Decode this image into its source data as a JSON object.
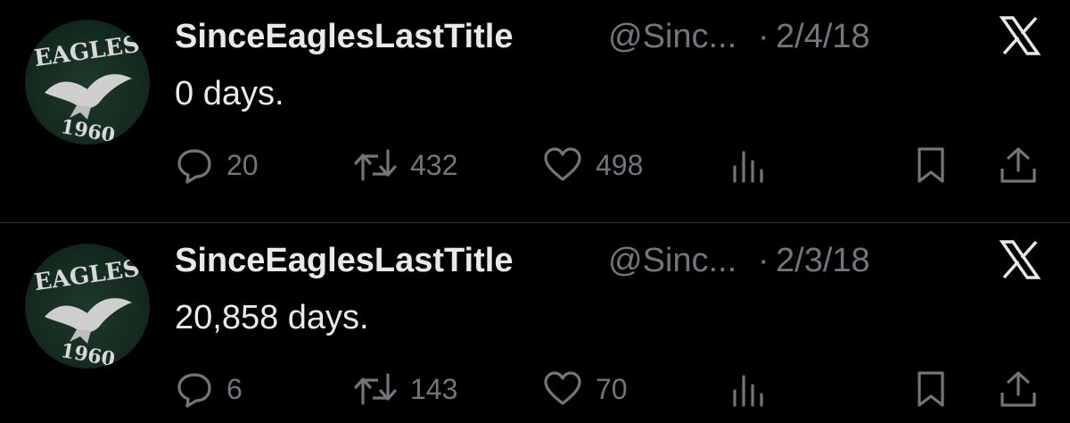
{
  "tweets": [
    {
      "author_name": "SinceEaglesLastTitle",
      "handle": "@Sinc...",
      "separator": "·",
      "date": "2/4/18",
      "text": "0 days.",
      "avatar": {
        "top_text": "EAGLES",
        "bottom_text": "1960"
      },
      "stats": {
        "replies": "20",
        "retweets": "432",
        "likes": "498"
      }
    },
    {
      "author_name": "SinceEaglesLastTitle",
      "handle": "@Sinc...",
      "separator": "·",
      "date": "2/3/18",
      "text": "20,858 days.",
      "avatar": {
        "top_text": "EAGLES",
        "bottom_text": "1960"
      },
      "stats": {
        "replies": "6",
        "retweets": "143",
        "likes": "70"
      }
    }
  ],
  "icons": {
    "reply": "reply-icon",
    "retweet": "retweet-icon",
    "like": "heart-icon",
    "views": "views-icon",
    "bookmark": "bookmark-icon",
    "share": "share-icon",
    "platform": "x-logo-icon"
  },
  "colors": {
    "background": "#000000",
    "primary_text": "#e7e9ea",
    "secondary_text": "#71767b",
    "divider": "#2f3336",
    "avatar_green": "#1e3a2b"
  }
}
